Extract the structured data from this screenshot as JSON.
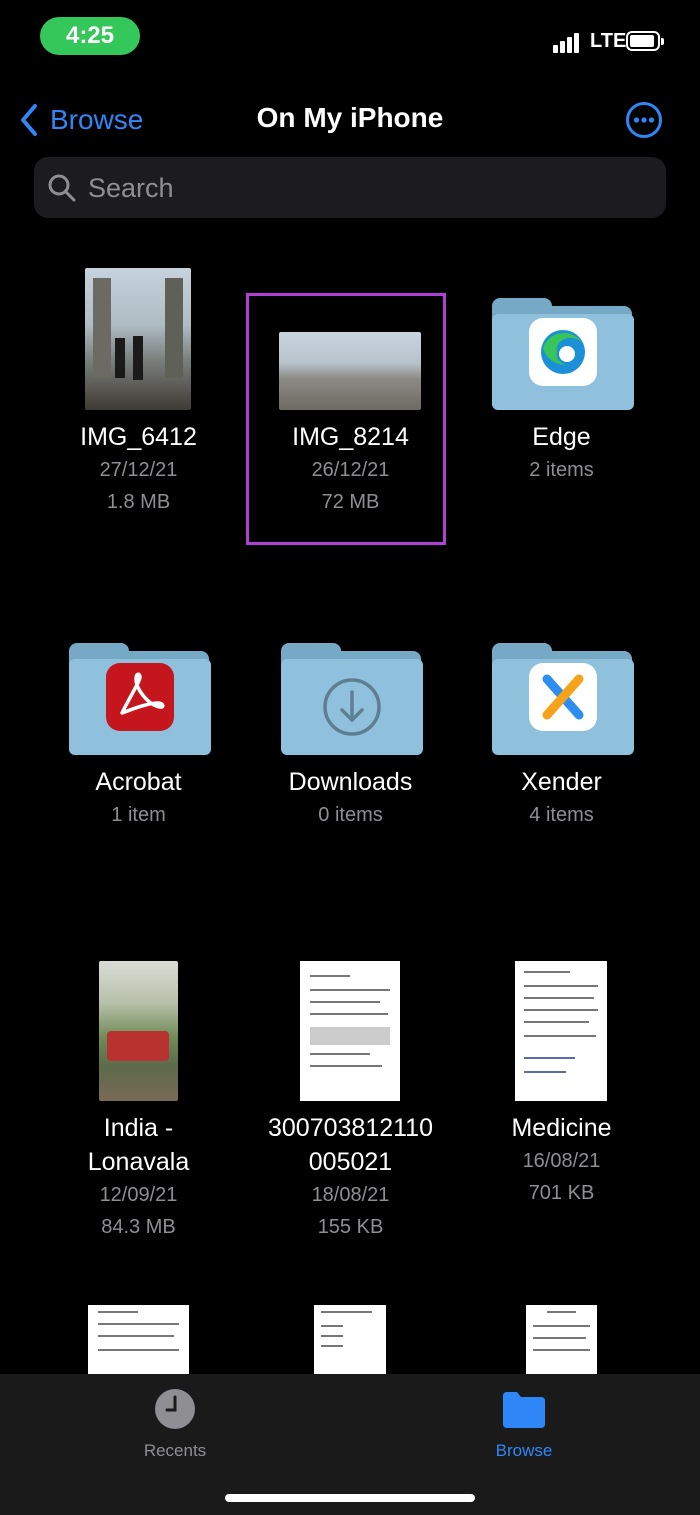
{
  "status": {
    "time": "4:25",
    "network": "LTE"
  },
  "nav": {
    "back_label": "Browse",
    "title": "On My iPhone"
  },
  "search": {
    "placeholder": "Search",
    "value": ""
  },
  "items": [
    {
      "name": "IMG_6412",
      "line1": "27/12/21",
      "line2": "1.8 MB",
      "kind": "photo"
    },
    {
      "name": "IMG_8214",
      "line1": "26/12/21",
      "line2": "72 MB",
      "kind": "photo"
    },
    {
      "name": "Edge",
      "line1": "2 items",
      "kind": "folder"
    },
    {
      "name": "Acrobat",
      "line1": "1 item",
      "kind": "folder"
    },
    {
      "name": "Downloads",
      "line1": "0 items",
      "kind": "folder"
    },
    {
      "name": "Xender",
      "line1": "4 items",
      "kind": "folder"
    },
    {
      "name": "India -\nLonavala",
      "line1": "12/09/21",
      "line2": "84.3 MB",
      "kind": "photo"
    },
    {
      "name": "300703812110\n005021",
      "line1": "18/08/21",
      "line2": "155 KB",
      "kind": "document"
    },
    {
      "name": "Medicine",
      "line1": "16/08/21",
      "line2": "701 KB",
      "kind": "document"
    }
  ],
  "tabbar": {
    "recents_label": "Recents",
    "browse_label": "Browse"
  },
  "colors": {
    "accent": "#2f86f6",
    "highlight": "#b13fd6",
    "status_pill": "#34c759",
    "folder": "#8fc1dd"
  }
}
